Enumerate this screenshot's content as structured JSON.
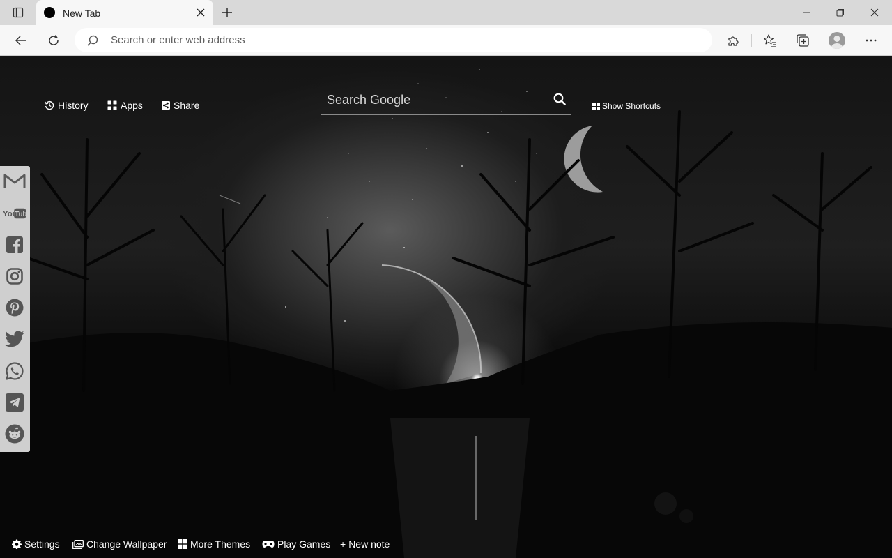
{
  "browser": {
    "tab": {
      "title": "New Tab"
    },
    "address_bar": {
      "placeholder": "Search or enter web address",
      "value": ""
    }
  },
  "page": {
    "top_links": [
      {
        "label": "History",
        "icon": "history-icon"
      },
      {
        "label": "Apps",
        "icon": "apps-grid-icon"
      },
      {
        "label": "Share",
        "icon": "share-icon"
      }
    ],
    "search": {
      "placeholder": "Search Google",
      "icon": "search-icon"
    },
    "show_shortcuts": {
      "label": "Show Shortcuts",
      "icon": "grid-icon"
    },
    "social_links": [
      {
        "name": "Gmail",
        "icon": "gmail-icon"
      },
      {
        "name": "YouTube",
        "icon": "youtube-icon"
      },
      {
        "name": "Facebook",
        "icon": "facebook-icon"
      },
      {
        "name": "Instagram",
        "icon": "instagram-icon"
      },
      {
        "name": "Pinterest",
        "icon": "pinterest-icon"
      },
      {
        "name": "Twitter",
        "icon": "twitter-icon"
      },
      {
        "name": "WhatsApp",
        "icon": "whatsapp-icon"
      },
      {
        "name": "Telegram",
        "icon": "telegram-icon"
      },
      {
        "name": "Reddit",
        "icon": "reddit-icon"
      }
    ],
    "youtube_logo_text": {
      "you": "You",
      "tube": "Tube"
    },
    "bottom_links": [
      {
        "label": "Settings",
        "icon": "gear-icon"
      },
      {
        "label": "Change Wallpaper",
        "icon": "image-icon"
      },
      {
        "label": "More Themes",
        "icon": "windows-grid-icon"
      },
      {
        "label": "Play Games",
        "icon": "gamepad-icon"
      },
      {
        "label": "New note",
        "icon": "plus-icon"
      }
    ]
  },
  "theme": {
    "chrome_bg": "#d9d9d9",
    "toolbar_bg": "#f7f7f7",
    "page_text": "#ffffff",
    "social_bar_bg": "#cfcfcf"
  }
}
